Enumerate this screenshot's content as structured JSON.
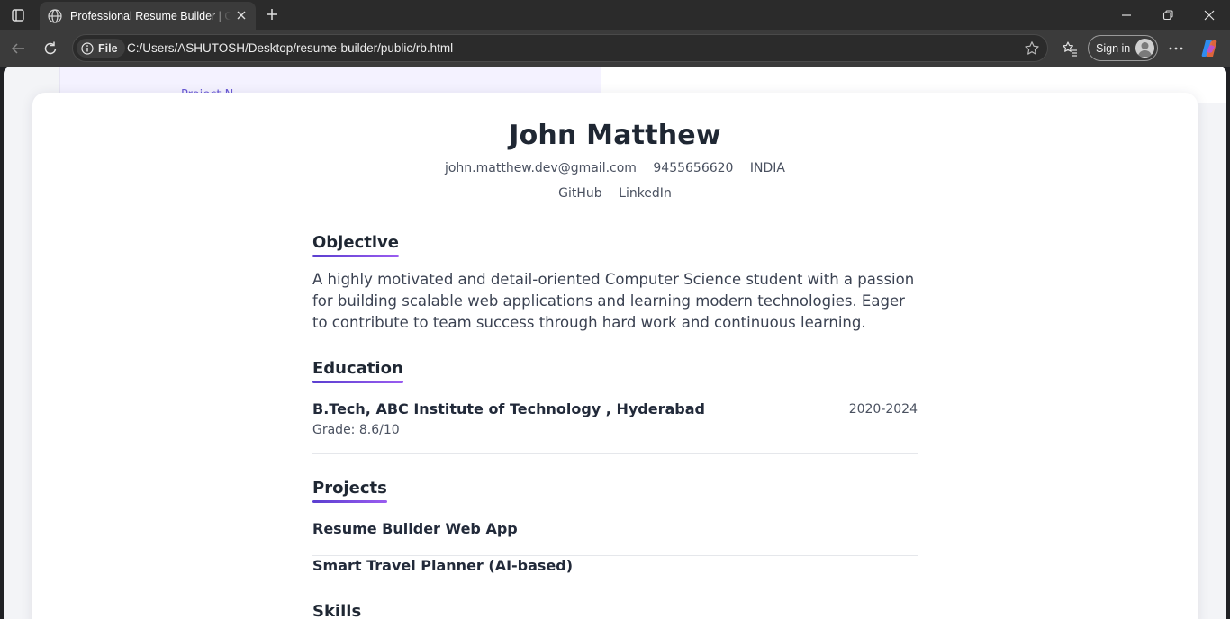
{
  "browser": {
    "tab_title": "Professional Resume Builder | Craft",
    "address_chip": "File",
    "url": "C:/Users/ASHUTOSH/Desktop/resume-builder/public/rb.html",
    "sign_in_label": "Sign in"
  },
  "behind": {
    "partial_text": "Project N"
  },
  "resume": {
    "name": "John Matthew",
    "email": "john.matthew.dev@gmail.com",
    "phone": "9455656620",
    "country": "INDIA",
    "links": [
      "GitHub",
      "LinkedIn"
    ],
    "sections": {
      "objective_title": "Objective",
      "objective_text": "A highly motivated and detail-oriented Computer Science student with a passion for building scalable web applications and learning modern technologies. Eager to contribute to team success through hard work and continuous learning.",
      "education_title": "Education",
      "education": {
        "degree": "B.Tech, ABC Institute of Technology , Hyderabad",
        "years": "2020-2024",
        "grade": "Grade: 8.6/10"
      },
      "projects_title": "Projects",
      "projects": [
        "Resume Builder Web App",
        "Smart Travel Planner (AI-based)"
      ],
      "skills_title": "Skills"
    }
  },
  "colors": {
    "accent_start": "#5b3fd0",
    "accent_end": "#9a5cf0"
  }
}
